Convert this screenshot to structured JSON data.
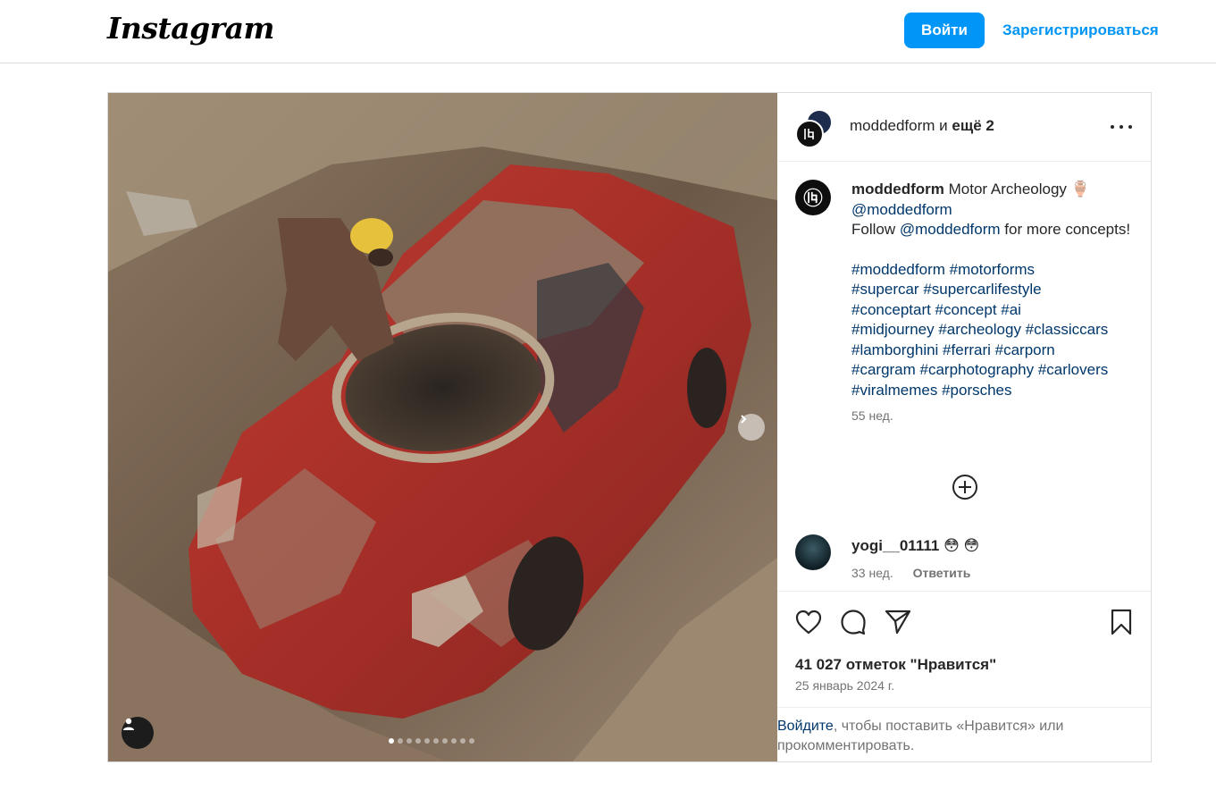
{
  "header": {
    "logo_text": "Instagram",
    "login_label": "Войти",
    "signup_label": "Зарегистрироваться"
  },
  "post": {
    "header": {
      "username": "moddedform",
      "and_text": "и",
      "others_text": "ещё 2"
    },
    "caption": {
      "username": "moddedform",
      "title": "Motor Archeology",
      "title_emoji": "🏺",
      "mention1": "@moddedform",
      "follow_prefix": "Follow",
      "mention2": "@moddedform",
      "follow_suffix": "for more concepts!",
      "hashtags": [
        "#moddedform #motorforms",
        "#supercar #supercarlifestyle",
        "#conceptart #concept #ai",
        "#midjourney #archeology #classiccars",
        "#lamborghini #ferrari #carporn",
        "#cargram #carphotography #carlovers",
        "#viralmemes #porsches"
      ],
      "time": "55 нед."
    },
    "comment": {
      "username": "yogi__01111",
      "text": "😳 😳",
      "time": "33 нед.",
      "reply_label": "Ответить"
    },
    "likes_text": "41 027 отметок \"Нравится\"",
    "date_text": "25 январь 2024 г.",
    "login_prompt": {
      "link_text": "Войдите",
      "rest_text": ", чтобы поставить «Нравится» или прокомментировать."
    },
    "carousel": {
      "total_slides": 10,
      "active_slide": 1
    }
  },
  "colors": {
    "accent": "#0095f6",
    "link": "#00376b",
    "muted": "#737373",
    "car_red": "#b4302a"
  }
}
